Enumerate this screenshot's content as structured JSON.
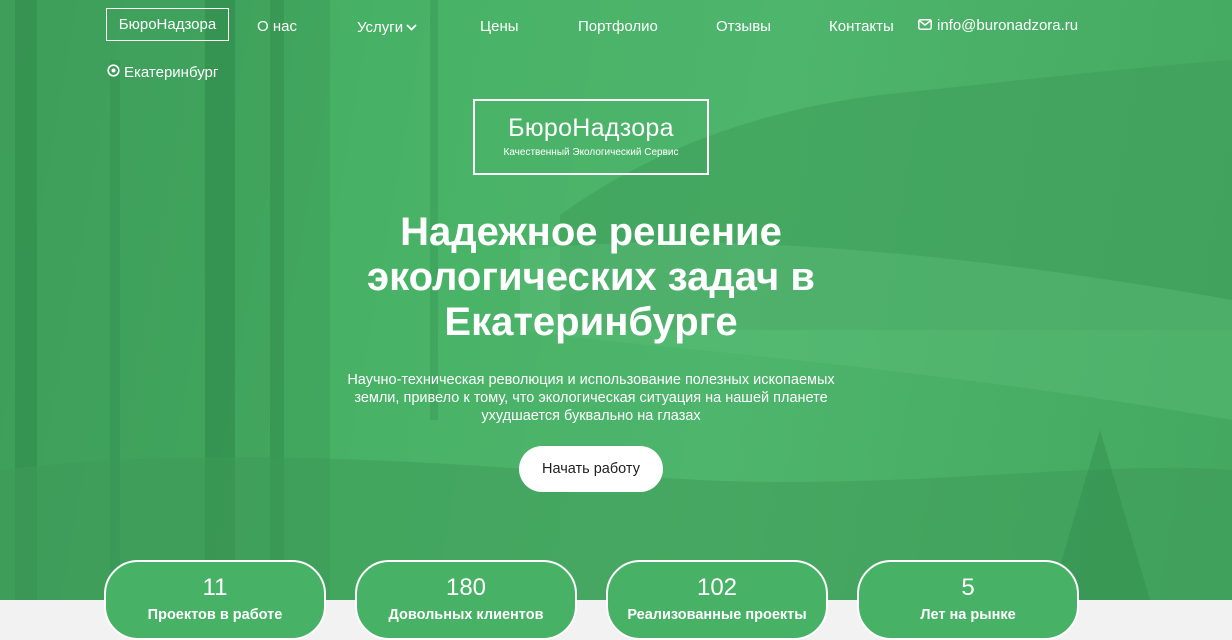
{
  "nav": {
    "logo": "БюроНадзора",
    "links": [
      "О нас",
      "Услуги",
      "Цены",
      "Портфолио",
      "Отзывы",
      "Контакты"
    ],
    "email": "info@buronadzora.ru",
    "city": "Екатеринбург"
  },
  "brand": {
    "name": "БюроНадзора",
    "tagline": "Качественный Экологический Сервис"
  },
  "hero": {
    "headline": "Надежное решение экологических задач в Екатеринбурге",
    "subtitle": "Научно-техническая революция и использование полезных ископаемых земли, привело к тому, что экологическая ситуация на нашей планете ухудшается буквально на глазах",
    "cta": "Начать работу"
  },
  "stats": [
    {
      "value": "11",
      "label": "Проектов в работе"
    },
    {
      "value": "180",
      "label": "Довольных клиентов"
    },
    {
      "value": "102",
      "label": "Реализованные проекты"
    },
    {
      "value": "5",
      "label": "Лет на рынке"
    }
  ],
  "colors": {
    "overlay_green": "#47b266",
    "white": "#ffffff",
    "strip": "#f2f2f2"
  },
  "icons": {
    "email": "mail-icon",
    "city": "location-pin-icon",
    "dropdown": "chevron-down-icon"
  }
}
